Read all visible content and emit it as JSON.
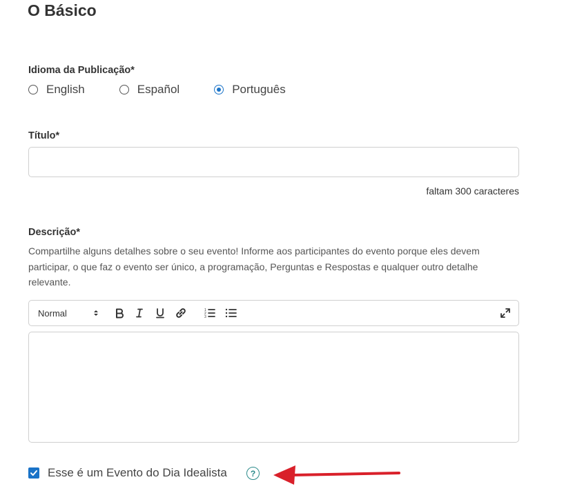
{
  "section": {
    "title": "O Básico"
  },
  "language": {
    "label": "Idioma da Publicação*",
    "options": [
      {
        "label": "English",
        "selected": false
      },
      {
        "label": "Español",
        "selected": false
      },
      {
        "label": "Português",
        "selected": true
      }
    ]
  },
  "title_field": {
    "label": "Título*",
    "value": "",
    "placeholder": "",
    "remaining": "faltam 300 caracteres"
  },
  "description": {
    "label": "Descrição*",
    "help": "Compartilhe alguns detalhes sobre o seu evento! Informe aos participantes do evento porque eles devem participar, o que faz o evento ser único, a programação, Perguntas e Respostas e qualquer outro detalhe relevante.",
    "toolbar": {
      "format_select": "Normal",
      "icons": [
        "bold-icon",
        "italic-icon",
        "underline-icon",
        "link-icon",
        "ordered-list-icon",
        "bullet-list-icon",
        "expand-icon"
      ]
    },
    "value": ""
  },
  "idealist_day": {
    "label": "Esse é um Evento do Dia Idealista",
    "checked": true,
    "help_icon": "?"
  },
  "colors": {
    "accent": "#1a73c8",
    "help_icon": "#2a8a8a",
    "annotation_arrow": "#d9202a"
  }
}
